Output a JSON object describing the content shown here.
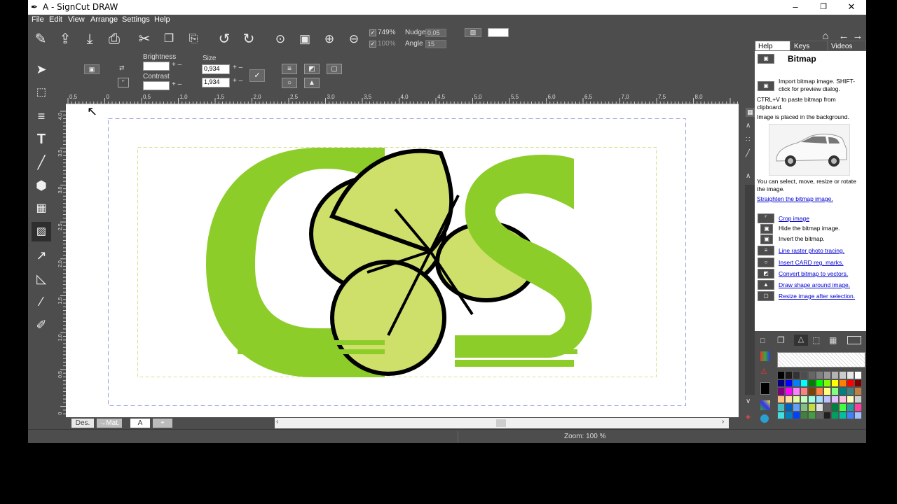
{
  "window": {
    "title": "A - SignCut DRAW"
  },
  "menu": [
    "File",
    "Edit",
    "View",
    "Arrange",
    "Settings",
    "Help"
  ],
  "toolbar": {
    "zoom_pct": "749%",
    "zoom_pct2": "100%",
    "nudge_label": "Nudge",
    "nudge_value": "0,05",
    "angle_label": "Angle",
    "angle_value": "15"
  },
  "bitmap_props": {
    "brightness_label": "Brightness",
    "contrast_label": "Contrast",
    "size_label": "Size",
    "size_w": "0,934",
    "size_h": "1,934"
  },
  "ruler": {
    "top_ticks": [
      "0,5",
      "0",
      "0,5",
      "1,0",
      "1,5",
      "2,0",
      "2,5",
      "3,0",
      "3,5",
      "4,0",
      "4,5",
      "5,0",
      "5,5",
      "6,0",
      "6,5",
      "7,0",
      "7,5",
      "8,0"
    ],
    "left_ticks": [
      "4,0",
      "3,5",
      "3,0",
      "2,5",
      "2,0",
      "1,5",
      "1,0",
      "0,5",
      "0"
    ]
  },
  "page_tabs": {
    "design": "Des.",
    "material": "→Mat.",
    "page_a": "A",
    "add": "+",
    "close": "×"
  },
  "status": {
    "zoom": "Zoom: 100 %"
  },
  "help": {
    "tabs": [
      "Help",
      "Keys",
      "Videos"
    ],
    "heading": "Bitmap",
    "import_text": "Import bitmap image. SHIFT-click for preview dialog.",
    "paste_text": "CTRL+V to paste bitmap from clipboard.",
    "placed_text": "Image is placed in the background.",
    "select_text": "You can select, move, resize or rotate the image.",
    "straighten_link": "Straighten the bitmap image.",
    "items": [
      {
        "label": "Crop image",
        "link": true
      },
      {
        "label": "Hide the bitmap image.",
        "link": false
      },
      {
        "label": "Invert the bitmap.",
        "link": false
      },
      {
        "label": "Line raster photo tracing.",
        "link": true
      },
      {
        "label": "Insert CARD reg. marks.",
        "link": true
      },
      {
        "label": "Convert bitmap to vectors.",
        "link": true
      },
      {
        "label": "Draw shape around image.",
        "link": true
      },
      {
        "label": "Resize image after selection.",
        "link": true
      }
    ]
  },
  "colors": {
    "logo_green": "#8dcd2a",
    "logo_light_green": "#cfe06a",
    "panel_gray": "#4d4d4d",
    "palette": [
      "#000000",
      "#1a1a1a",
      "#333333",
      "#4d4d4d",
      "#666666",
      "#808080",
      "#999999",
      "#b3b3b3",
      "#cccccc",
      "#e6e6e6",
      "#ffffff",
      "#000080",
      "#0000ff",
      "#0080ff",
      "#00ffff",
      "#008000",
      "#00ff00",
      "#80ff00",
      "#ffff00",
      "#ff8000",
      "#ff0000",
      "#800000",
      "#800080",
      "#ff00ff",
      "#ff80ff",
      "#ff8080",
      "#804000",
      "#ff8040",
      "#ffff80",
      "#80ff80",
      "#008080",
      "#408080",
      "#c08040",
      "#ffc080",
      "#ffe0a0",
      "#e0ffa0",
      "#c0ffc0",
      "#a0ffe0",
      "#a0e0ff",
      "#c0c0ff",
      "#e0c0ff",
      "#ffc0e0",
      "#ffffc0",
      "#d0d0d0",
      "#40c0c0",
      "#0060c0",
      "#60a0ff",
      "#80c080",
      "#c0e040",
      "#e0e0e0",
      "#606060",
      "#008040",
      "#40ff40",
      "#20a0a0",
      "#ff40a0",
      "#40e0e0",
      "#0080c0",
      "#0040ff",
      "#408040",
      "#40a040",
      "#606060",
      "#202020",
      "#00a060",
      "#00c0a0",
      "#4080ff",
      "#a0c0ff"
    ]
  }
}
